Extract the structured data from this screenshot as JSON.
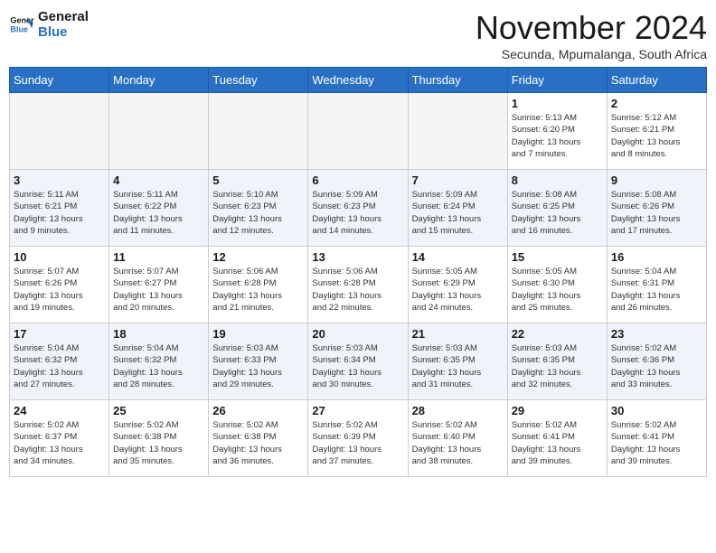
{
  "logo": {
    "line1": "General",
    "line2": "Blue"
  },
  "title": "November 2024",
  "subtitle": "Secunda, Mpumalanga, South Africa",
  "headers": [
    "Sunday",
    "Monday",
    "Tuesday",
    "Wednesday",
    "Thursday",
    "Friday",
    "Saturday"
  ],
  "weeks": [
    {
      "days": [
        {
          "num": "",
          "info": ""
        },
        {
          "num": "",
          "info": ""
        },
        {
          "num": "",
          "info": ""
        },
        {
          "num": "",
          "info": ""
        },
        {
          "num": "",
          "info": ""
        },
        {
          "num": "1",
          "info": "Sunrise: 5:13 AM\nSunset: 6:20 PM\nDaylight: 13 hours\nand 7 minutes."
        },
        {
          "num": "2",
          "info": "Sunrise: 5:12 AM\nSunset: 6:21 PM\nDaylight: 13 hours\nand 8 minutes."
        }
      ]
    },
    {
      "days": [
        {
          "num": "3",
          "info": "Sunrise: 5:11 AM\nSunset: 6:21 PM\nDaylight: 13 hours\nand 9 minutes."
        },
        {
          "num": "4",
          "info": "Sunrise: 5:11 AM\nSunset: 6:22 PM\nDaylight: 13 hours\nand 11 minutes."
        },
        {
          "num": "5",
          "info": "Sunrise: 5:10 AM\nSunset: 6:23 PM\nDaylight: 13 hours\nand 12 minutes."
        },
        {
          "num": "6",
          "info": "Sunrise: 5:09 AM\nSunset: 6:23 PM\nDaylight: 13 hours\nand 14 minutes."
        },
        {
          "num": "7",
          "info": "Sunrise: 5:09 AM\nSunset: 6:24 PM\nDaylight: 13 hours\nand 15 minutes."
        },
        {
          "num": "8",
          "info": "Sunrise: 5:08 AM\nSunset: 6:25 PM\nDaylight: 13 hours\nand 16 minutes."
        },
        {
          "num": "9",
          "info": "Sunrise: 5:08 AM\nSunset: 6:26 PM\nDaylight: 13 hours\nand 17 minutes."
        }
      ]
    },
    {
      "days": [
        {
          "num": "10",
          "info": "Sunrise: 5:07 AM\nSunset: 6:26 PM\nDaylight: 13 hours\nand 19 minutes."
        },
        {
          "num": "11",
          "info": "Sunrise: 5:07 AM\nSunset: 6:27 PM\nDaylight: 13 hours\nand 20 minutes."
        },
        {
          "num": "12",
          "info": "Sunrise: 5:06 AM\nSunset: 6:28 PM\nDaylight: 13 hours\nand 21 minutes."
        },
        {
          "num": "13",
          "info": "Sunrise: 5:06 AM\nSunset: 6:28 PM\nDaylight: 13 hours\nand 22 minutes."
        },
        {
          "num": "14",
          "info": "Sunrise: 5:05 AM\nSunset: 6:29 PM\nDaylight: 13 hours\nand 24 minutes."
        },
        {
          "num": "15",
          "info": "Sunrise: 5:05 AM\nSunset: 6:30 PM\nDaylight: 13 hours\nand 25 minutes."
        },
        {
          "num": "16",
          "info": "Sunrise: 5:04 AM\nSunset: 6:31 PM\nDaylight: 13 hours\nand 26 minutes."
        }
      ]
    },
    {
      "days": [
        {
          "num": "17",
          "info": "Sunrise: 5:04 AM\nSunset: 6:32 PM\nDaylight: 13 hours\nand 27 minutes."
        },
        {
          "num": "18",
          "info": "Sunrise: 5:04 AM\nSunset: 6:32 PM\nDaylight: 13 hours\nand 28 minutes."
        },
        {
          "num": "19",
          "info": "Sunrise: 5:03 AM\nSunset: 6:33 PM\nDaylight: 13 hours\nand 29 minutes."
        },
        {
          "num": "20",
          "info": "Sunrise: 5:03 AM\nSunset: 6:34 PM\nDaylight: 13 hours\nand 30 minutes."
        },
        {
          "num": "21",
          "info": "Sunrise: 5:03 AM\nSunset: 6:35 PM\nDaylight: 13 hours\nand 31 minutes."
        },
        {
          "num": "22",
          "info": "Sunrise: 5:03 AM\nSunset: 6:35 PM\nDaylight: 13 hours\nand 32 minutes."
        },
        {
          "num": "23",
          "info": "Sunrise: 5:02 AM\nSunset: 6:36 PM\nDaylight: 13 hours\nand 33 minutes."
        }
      ]
    },
    {
      "days": [
        {
          "num": "24",
          "info": "Sunrise: 5:02 AM\nSunset: 6:37 PM\nDaylight: 13 hours\nand 34 minutes."
        },
        {
          "num": "25",
          "info": "Sunrise: 5:02 AM\nSunset: 6:38 PM\nDaylight: 13 hours\nand 35 minutes."
        },
        {
          "num": "26",
          "info": "Sunrise: 5:02 AM\nSunset: 6:38 PM\nDaylight: 13 hours\nand 36 minutes."
        },
        {
          "num": "27",
          "info": "Sunrise: 5:02 AM\nSunset: 6:39 PM\nDaylight: 13 hours\nand 37 minutes."
        },
        {
          "num": "28",
          "info": "Sunrise: 5:02 AM\nSunset: 6:40 PM\nDaylight: 13 hours\nand 38 minutes."
        },
        {
          "num": "29",
          "info": "Sunrise: 5:02 AM\nSunset: 6:41 PM\nDaylight: 13 hours\nand 39 minutes."
        },
        {
          "num": "30",
          "info": "Sunrise: 5:02 AM\nSunset: 6:41 PM\nDaylight: 13 hours\nand 39 minutes."
        }
      ]
    }
  ]
}
